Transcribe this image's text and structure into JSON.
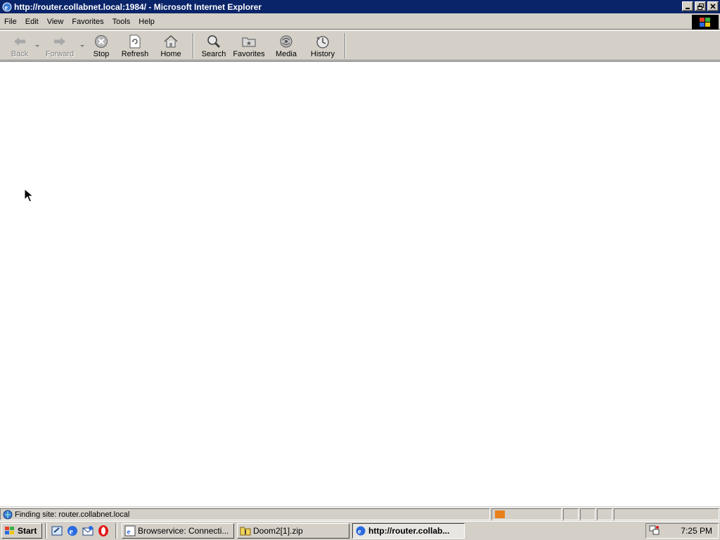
{
  "window": {
    "title": "http://router.collabnet.local:1984/ - Microsoft Internet Explorer"
  },
  "menu": [
    "File",
    "Edit",
    "View",
    "Favorites",
    "Tools",
    "Help"
  ],
  "toolbar": {
    "back": "Back",
    "forward": "Forward",
    "stop": "Stop",
    "refresh": "Refresh",
    "home": "Home",
    "search": "Search",
    "favorites": "Favorites",
    "media": "Media",
    "history": "History"
  },
  "status": {
    "text": "Finding site: router.collabnet.local",
    "progress_color": "#e8801a"
  },
  "taskbar": {
    "start": "Start",
    "tasks": [
      "Browservice: Connecti...",
      "Doom2[1].zip",
      "http://router.collab..."
    ],
    "clock": "7:25 PM"
  }
}
